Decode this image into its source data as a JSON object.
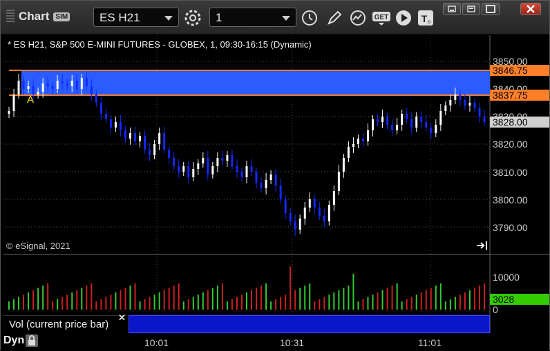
{
  "window": {
    "app_title": "Chart",
    "sim_badge": "SIM",
    "symbol_field": "ES H21",
    "interval_field": "1"
  },
  "chart": {
    "legend_title": "* ES H21, S&P 500 E-MINI FUTURES - GLOBEX, 1, 09:30-16:15 (Dynamic)",
    "copyright": "© eSignal, 2021",
    "zone_label": "A",
    "price_ticks": [
      "3850.00",
      "3840.00",
      "3830.00",
      "3820.00",
      "3810.00",
      "3800.00",
      "3790.00"
    ],
    "price_tags": [
      {
        "text": "3846.75",
        "bg": "#ff7f2a",
        "color": "#000"
      },
      {
        "text": "3837.75",
        "bg": "#ff7f2a",
        "color": "#000"
      },
      {
        "text": "3828.00",
        "bg": "#d0d0d0",
        "color": "#000"
      }
    ],
    "volume_ticks": [
      "10000",
      "0"
    ],
    "volume_tag": {
      "text": "3028",
      "bg": "#33cc00",
      "color": "#000"
    },
    "volume_label": "Vol (current price bar)",
    "x_ticks": [
      "10:01",
      "10:31",
      "11:01"
    ],
    "dyn_label": "Dyn",
    "colors": {
      "zone_fill": "#2a5cff",
      "zone_line": "#ff7f2a",
      "up_candle": "#ffffff",
      "down_candle": "#1428ff",
      "vol_up": "#33cc33",
      "vol_down": "#cc2020"
    }
  },
  "icons": [
    "settings-gear-icon",
    "clock-icon",
    "pencil-icon",
    "indicator-icon",
    "get-icon",
    "play-icon",
    "text-icon",
    "minimize-icon",
    "restore-icon",
    "maximize-icon",
    "close-icon",
    "scroll-right-icon",
    "lock-icon"
  ]
}
